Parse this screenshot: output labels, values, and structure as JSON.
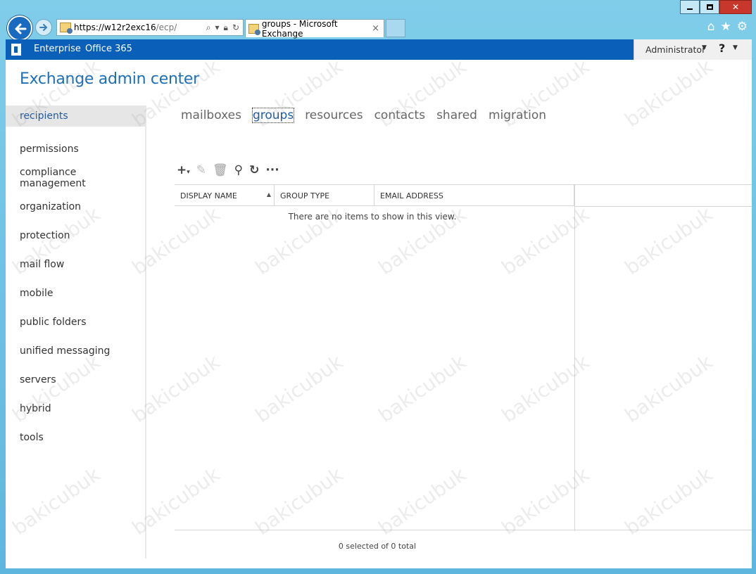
{
  "browser": {
    "url_host": "https://w12r2exc16",
    "url_path": "/ecp/",
    "tab_title": "groups - Microsoft Exchange",
    "tab_close": "×"
  },
  "o365bar": {
    "enterprise": "Enterprise",
    "office365": "Office 365",
    "user": "Administrator",
    "help": "?"
  },
  "app_title": "Exchange admin center",
  "sidebar": {
    "items": [
      {
        "label": "recipients"
      },
      {
        "label": "permissions"
      },
      {
        "label": "compliance management"
      },
      {
        "label": "organization"
      },
      {
        "label": "protection"
      },
      {
        "label": "mail flow"
      },
      {
        "label": "mobile"
      },
      {
        "label": "public folders"
      },
      {
        "label": "unified messaging"
      },
      {
        "label": "servers"
      },
      {
        "label": "hybrid"
      },
      {
        "label": "tools"
      }
    ]
  },
  "subtabs": [
    "mailboxes",
    "groups",
    "resources",
    "contacts",
    "shared",
    "migration"
  ],
  "grid": {
    "columns": [
      "DISPLAY NAME",
      "GROUP TYPE",
      "EMAIL ADDRESS"
    ],
    "empty_message": "There are no items to show in this view.",
    "status": "0 selected of 0 total"
  },
  "watermark": "bakicubuk",
  "icons": [
    "back-arrow-icon",
    "forward-arrow-icon",
    "search-icon",
    "lock-icon",
    "refresh-icon",
    "home-icon",
    "favorites-star-icon",
    "settings-gear-icon",
    "add-icon",
    "edit-icon",
    "delete-icon",
    "search-icon",
    "refresh-icon",
    "more-icon"
  ]
}
